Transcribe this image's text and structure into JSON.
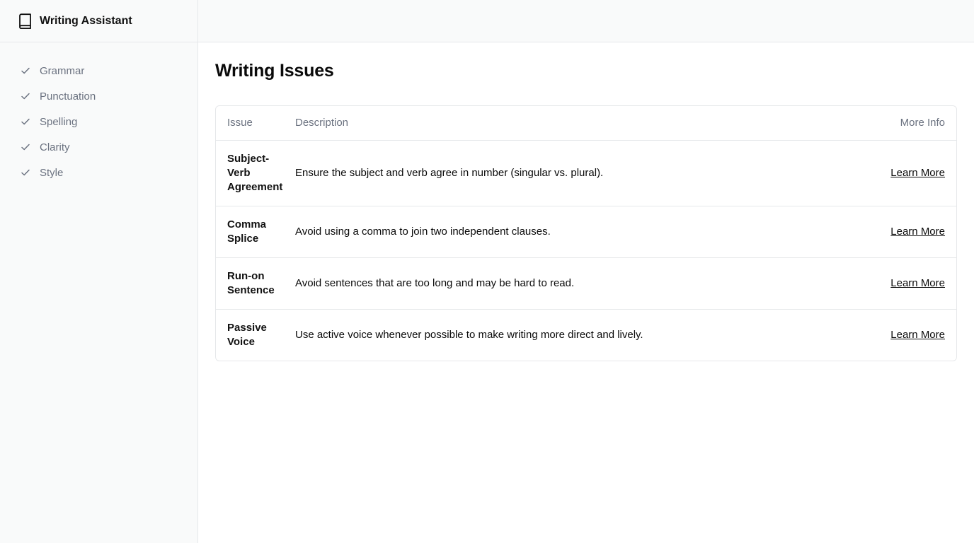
{
  "app": {
    "title": "Writing Assistant",
    "icon": "book-icon"
  },
  "sidebar": {
    "items": [
      {
        "label": "Grammar",
        "icon": "check-icon"
      },
      {
        "label": "Punctuation",
        "icon": "check-icon"
      },
      {
        "label": "Spelling",
        "icon": "check-icon"
      },
      {
        "label": "Clarity",
        "icon": "check-icon"
      },
      {
        "label": "Style",
        "icon": "check-icon"
      }
    ]
  },
  "main": {
    "title": "Writing Issues",
    "table": {
      "headers": {
        "issue": "Issue",
        "description": "Description",
        "more_info": "More Info"
      },
      "rows": [
        {
          "issue": "Subject-Verb Agreement",
          "description": "Ensure the subject and verb agree in number (singular vs. plural).",
          "link": "Learn More"
        },
        {
          "issue": "Comma Splice",
          "description": "Avoid using a comma to join two independent clauses.",
          "link": "Learn More"
        },
        {
          "issue": "Run-on Sentence",
          "description": "Avoid sentences that are too long and may be hard to read.",
          "link": "Learn More"
        },
        {
          "issue": "Passive Voice",
          "description": "Use active voice whenever possible to make writing more direct and lively.",
          "link": "Learn More"
        }
      ]
    }
  },
  "colors": {
    "sidebar_bg": "#f9fafa",
    "border": "#e6e8ea",
    "muted_text": "#6b7280",
    "text": "#0a0a0a"
  }
}
